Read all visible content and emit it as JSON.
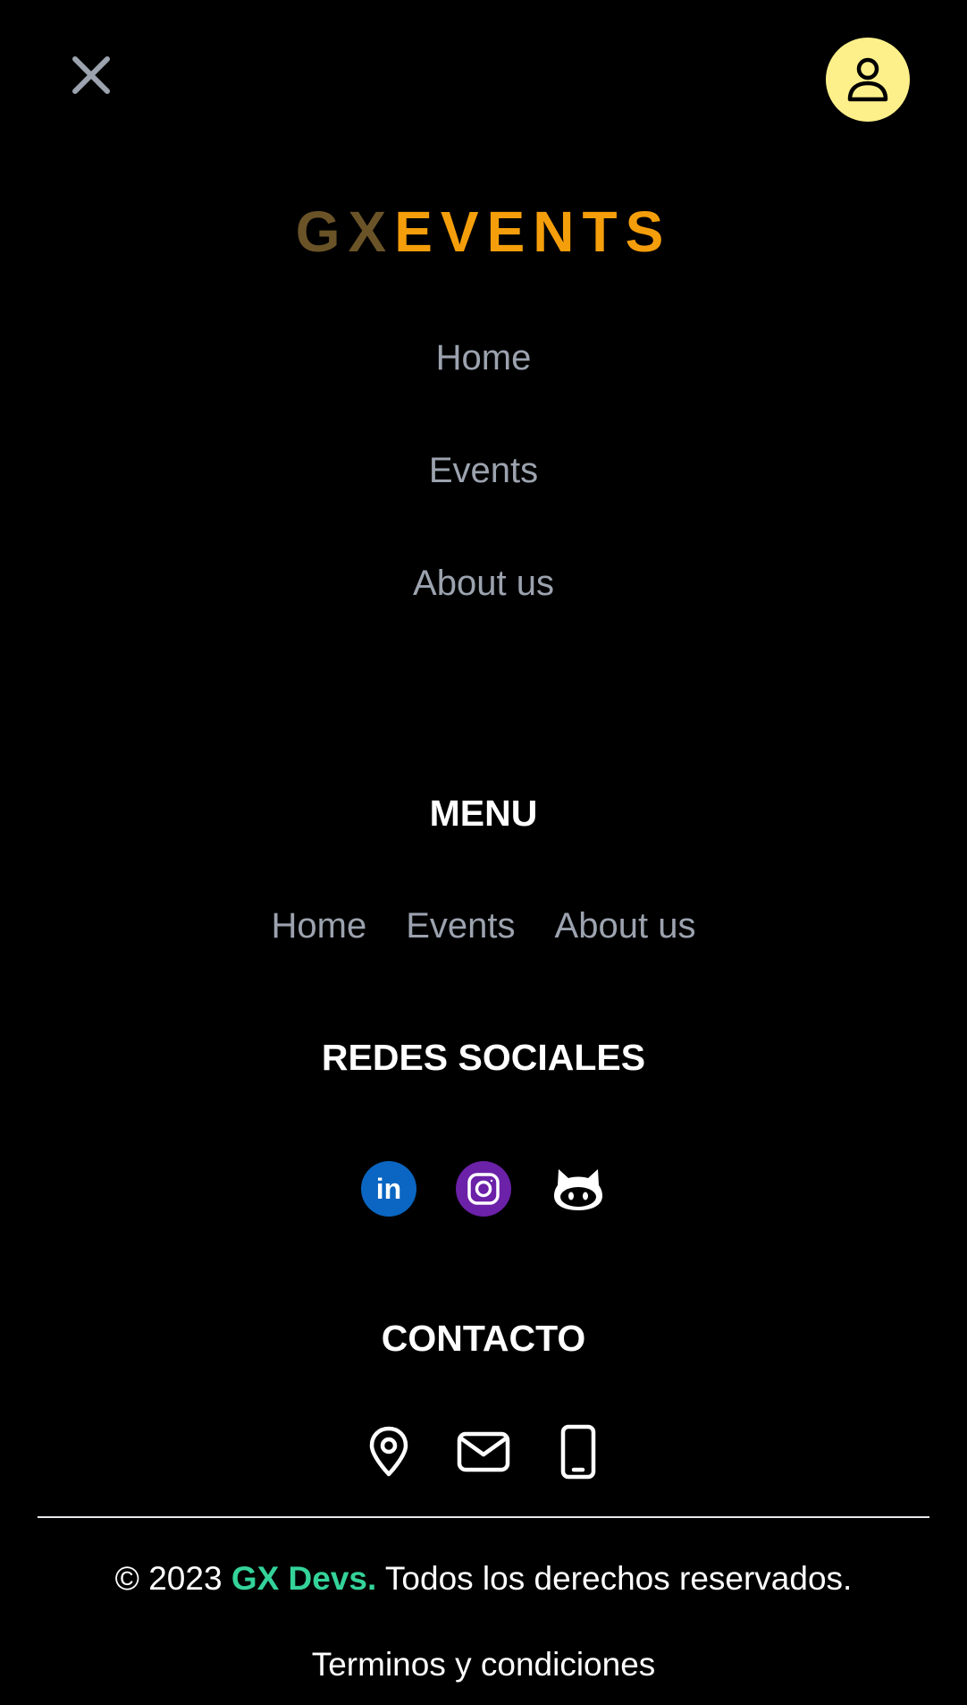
{
  "header": {
    "close_icon": "close-icon",
    "user_icon": "user-icon",
    "user_button_color": "#fdf08a"
  },
  "logo": {
    "part1": "GX",
    "part2": "EVENTS",
    "part1_color": "#6b5328",
    "part2_color": "#f59e0b"
  },
  "mobile_nav": {
    "items": [
      {
        "label": "Home"
      },
      {
        "label": "Events"
      },
      {
        "label": "About us"
      }
    ]
  },
  "footer": {
    "menu_heading": "MENU",
    "menu_items": [
      {
        "label": "Home"
      },
      {
        "label": "Events"
      },
      {
        "label": "About us"
      }
    ],
    "social_heading": "REDES SOCIALES",
    "social_icons": [
      "linkedin-icon",
      "instagram-icon",
      "github-icon"
    ],
    "linkedin_text": "in",
    "contact_heading": "CONTACTO",
    "contact_icons": [
      "location-pin-icon",
      "mail-icon",
      "phone-icon"
    ],
    "copyright_symbol_year": "© 2023",
    "copyright_brand": "GX Devs.",
    "copyright_rest": "Todos los derechos reservados.",
    "terms_label": "Terminos y condiciones",
    "brand_color": "#34d399"
  }
}
